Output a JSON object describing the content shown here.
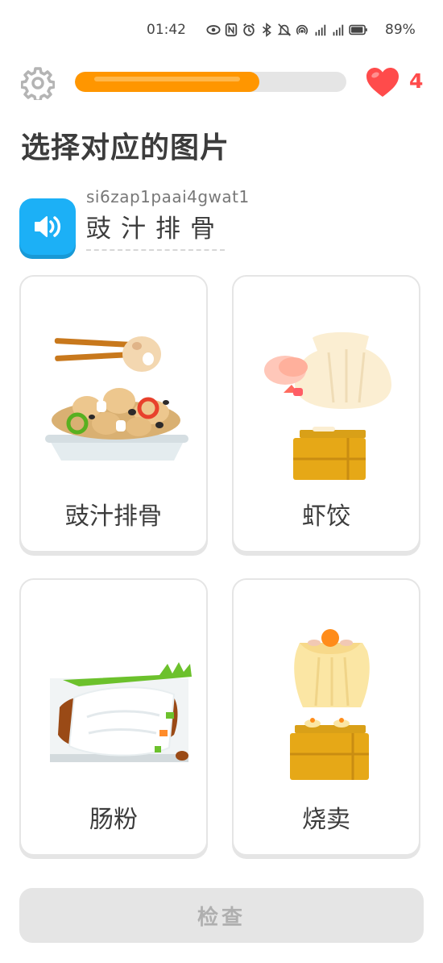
{
  "status_bar": {
    "time": "01:42",
    "battery": "89%",
    "icons": [
      "eye-icon",
      "nfc-icon",
      "alarm-icon",
      "bluetooth-icon",
      "mute-icon",
      "hotspot-icon",
      "signal-4g-icon",
      "signal-5g-icon",
      "battery-icon"
    ]
  },
  "header": {
    "progress_fraction": 0.68,
    "hearts": "4",
    "accent_color": "#ff9600",
    "heart_color": "#ff4b4b"
  },
  "challenge": {
    "title": "选择对应的图片",
    "romanization": "si6zap1paai4gwat1",
    "prompt": "豉汁排骨"
  },
  "choices": [
    {
      "label": "豉汁排骨",
      "icon": "black-bean-spareribs-image"
    },
    {
      "label": "虾饺",
      "icon": "shrimp-dumpling-image"
    },
    {
      "label": "肠粉",
      "icon": "rice-noodle-roll-image"
    },
    {
      "label": "烧卖",
      "icon": "siu-mai-image"
    }
  ],
  "footer": {
    "check_label": "检查"
  }
}
